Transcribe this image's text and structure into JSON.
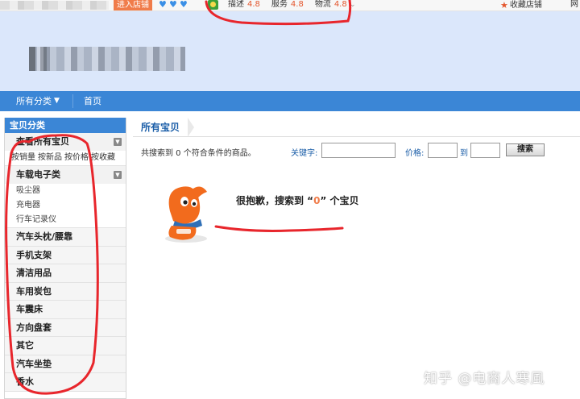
{
  "topbar": {
    "enter_shop": "进入店铺",
    "diamond_count": 3,
    "scores": [
      {
        "label": "描述",
        "value": "4.8"
      },
      {
        "label": "服务",
        "value": "4.8"
      },
      {
        "label": "物流",
        "value": "4.8"
      }
    ],
    "favorite_shop": "收藏店铺",
    "cut_text": "网"
  },
  "nav": {
    "all_categories": "所有分类",
    "home": "首页"
  },
  "sidebar": {
    "title": "宝贝分类",
    "view_all": "查看所有宝贝",
    "sort_options": [
      "按销量",
      "按新品",
      "按价格",
      "按收藏"
    ],
    "electronics": {
      "title": "车载电子类",
      "items": [
        "吸尘器",
        "充电器",
        "行车记录仪"
      ]
    },
    "categories": [
      "汽车头枕/腰靠",
      "手机支架",
      "清洁用品",
      "车用炭包",
      "车震床",
      "方向盘套",
      "其它",
      "汽车坐垫",
      "香水"
    ]
  },
  "main": {
    "title": "所有宝贝",
    "result_count": "共搜索到 0 个符合条件的商品。",
    "keyword_label": "关键字:",
    "keyword_value": "",
    "price_label": "价格:",
    "price_to": "到",
    "price_min": "",
    "price_max": "",
    "search_button": "搜索",
    "sorry_prefix": "很抱歉，搜索到 “",
    "sorry_count": "0",
    "sorry_suffix": "” 个宝贝"
  },
  "watermark": "知乎 @电商人寒風",
  "colors": {
    "nav_blue": "#3b86d6",
    "banner": "#dbe7fb",
    "accent_orange": "#f07c4a",
    "annotation_red": "#e8262c"
  }
}
